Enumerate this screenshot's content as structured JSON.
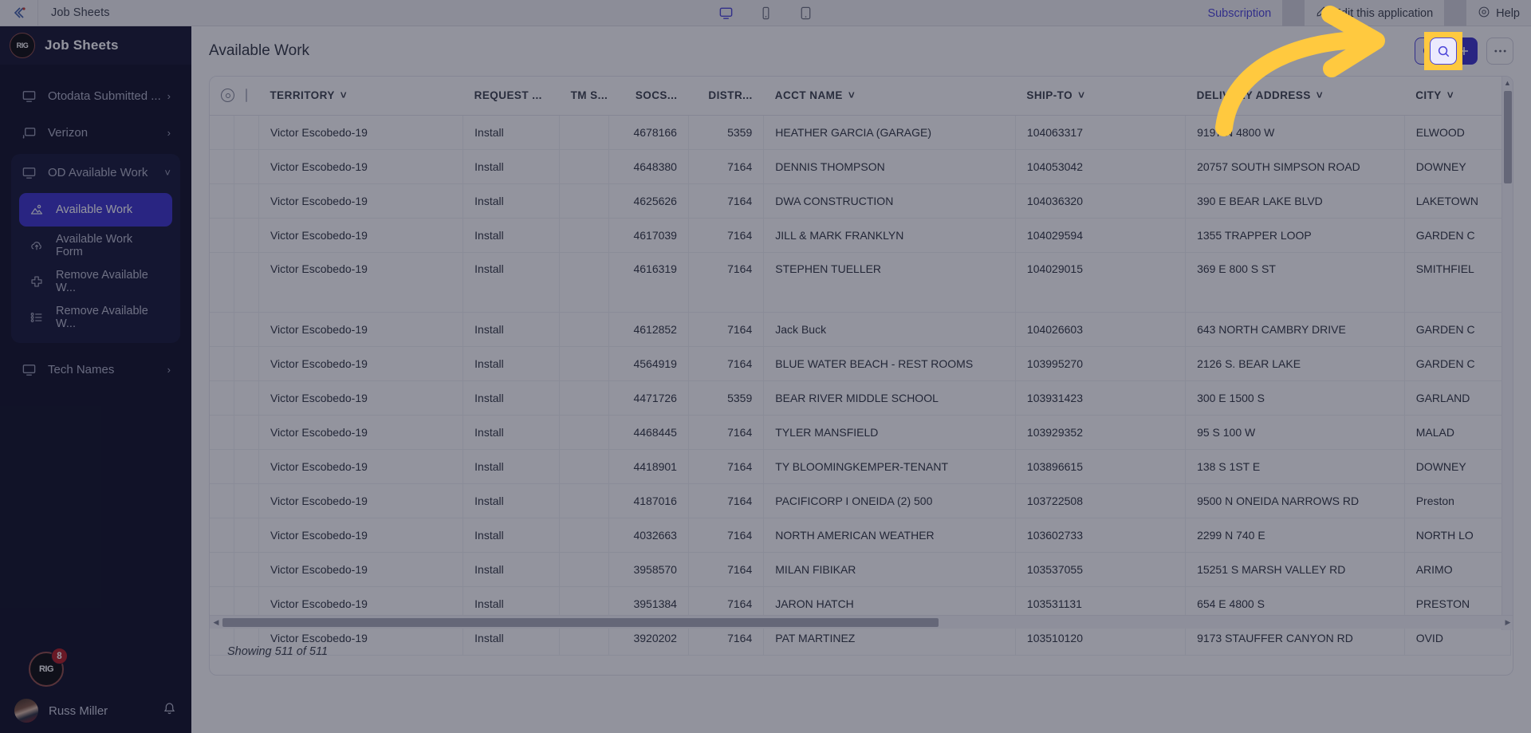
{
  "topbar": {
    "app_title": "Job Sheets",
    "devices": [
      {
        "name": "desktop-preview-icon",
        "active": true
      },
      {
        "name": "mobile-preview-icon",
        "active": false
      },
      {
        "name": "tablet-preview-icon",
        "active": false
      }
    ],
    "subscription_label": "Subscription",
    "edit_label": "Edit this application",
    "help_label": "Help"
  },
  "sidebar": {
    "brand": "Job Sheets",
    "logo_text": "RIG",
    "items": [
      {
        "label": "Otodata Submitted ...",
        "icon": "monitor-icon",
        "chevron": "right"
      },
      {
        "label": "Verizon",
        "icon": "cast-screen-icon",
        "chevron": "right"
      }
    ],
    "group": {
      "label": "OD Available Work",
      "icon": "monitor-icon",
      "chevron": "down",
      "children": [
        {
          "label": "Available Work",
          "icon": "image-icon",
          "active": true
        },
        {
          "label": "Available Work Form",
          "icon": "cloud-upload-icon",
          "active": false
        },
        {
          "label": "Remove Available W...",
          "icon": "plus-square-icon",
          "active": false
        },
        {
          "label": "Remove Available W...",
          "icon": "list-icon",
          "active": false
        }
      ]
    },
    "trailing": [
      {
        "label": "Tech Names",
        "icon": "monitor-icon",
        "chevron": "right"
      }
    ],
    "footer": {
      "badge_count": "8",
      "logo_text": "RIG",
      "user_name": "Russ Miller",
      "bell_icon": "bell-icon"
    }
  },
  "main": {
    "page_title": "Available Work",
    "actions": [
      {
        "name": "search-button",
        "icon": "search-icon"
      },
      {
        "name": "add-button",
        "icon": "plus-icon"
      },
      {
        "name": "more-button",
        "icon": "ellipsis-icon"
      }
    ],
    "table": {
      "columns": [
        {
          "key": "eye",
          "label": "",
          "icon": "visibility-icon",
          "sortable": false
        },
        {
          "key": "check",
          "label": "",
          "icon": "checkbox-icon",
          "sortable": false
        },
        {
          "key": "territory",
          "label": "TERRITORY",
          "sortable": true
        },
        {
          "key": "request",
          "label": "REQUEST ...",
          "sortable": false
        },
        {
          "key": "tms",
          "label": "TM S...",
          "sortable": false
        },
        {
          "key": "socs",
          "label": "SOCS...",
          "sortable": false
        },
        {
          "key": "distr",
          "label": "DISTR...",
          "sortable": false
        },
        {
          "key": "acct",
          "label": "ACCT NAME",
          "sortable": true
        },
        {
          "key": "ship",
          "label": "SHIP-TO",
          "sortable": true
        },
        {
          "key": "addr",
          "label": "DELIVERY ADDRESS",
          "sortable": true
        },
        {
          "key": "city",
          "label": "CITY",
          "sortable": true
        }
      ],
      "rows": [
        {
          "territory": "Victor Escobedo-19",
          "request": "Install",
          "tms": "",
          "socs": "4678166",
          "distr": "5359",
          "acct": "HEATHER GARCIA (GARAGE)",
          "ship": "104063317",
          "addr": "9197 N 4800 W",
          "city": "ELWOOD",
          "tall": false
        },
        {
          "territory": "Victor Escobedo-19",
          "request": "Install",
          "tms": "",
          "socs": "4648380",
          "distr": "7164",
          "acct": "DENNIS THOMPSON",
          "ship": "104053042",
          "addr": "20757 SOUTH SIMPSON ROAD",
          "city": "DOWNEY",
          "tall": false
        },
        {
          "territory": "Victor Escobedo-19",
          "request": "Install",
          "tms": "",
          "socs": "4625626",
          "distr": "7164",
          "acct": "DWA CONSTRUCTION",
          "ship": "104036320",
          "addr": "390 E BEAR LAKE BLVD",
          "city": "LAKETOWN",
          "tall": false
        },
        {
          "territory": "Victor Escobedo-19",
          "request": "Install",
          "tms": "",
          "socs": "4617039",
          "distr": "7164",
          "acct": "JILL & MARK FRANKLYN",
          "ship": "104029594",
          "addr": "1355 TRAPPER LOOP",
          "city": "GARDEN C",
          "tall": false
        },
        {
          "territory": "Victor Escobedo-19",
          "request": "Install",
          "tms": "",
          "socs": "4616319",
          "distr": "7164",
          "acct": "STEPHEN TUELLER",
          "ship": "104029015",
          "addr": "369 E 800 S ST",
          "city": "SMITHFIEL",
          "tall": true
        },
        {
          "territory": "Victor Escobedo-19",
          "request": "Install",
          "tms": "",
          "socs": "4612852",
          "distr": "7164",
          "acct": "Jack Buck",
          "ship": "104026603",
          "addr": "643 NORTH CAMBRY DRIVE",
          "city": "GARDEN C",
          "tall": false
        },
        {
          "territory": "Victor Escobedo-19",
          "request": "Install",
          "tms": "",
          "socs": "4564919",
          "distr": "7164",
          "acct": "BLUE WATER BEACH - REST ROOMS",
          "ship": "103995270",
          "addr": "2126 S. BEAR LAKE",
          "city": "GARDEN C",
          "tall": false
        },
        {
          "territory": "Victor Escobedo-19",
          "request": "Install",
          "tms": "",
          "socs": "4471726",
          "distr": "5359",
          "acct": "BEAR RIVER MIDDLE SCHOOL",
          "ship": "103931423",
          "addr": "300 E 1500 S",
          "city": "GARLAND",
          "tall": false
        },
        {
          "territory": "Victor Escobedo-19",
          "request": "Install",
          "tms": "",
          "socs": "4468445",
          "distr": "7164",
          "acct": "TYLER MANSFIELD",
          "ship": "103929352",
          "addr": "95 S 100 W",
          "city": "MALAD",
          "tall": false
        },
        {
          "territory": "Victor Escobedo-19",
          "request": "Install",
          "tms": "",
          "socs": "4418901",
          "distr": "7164",
          "acct": "TY BLOOMINGKEMPER-TENANT",
          "ship": "103896615",
          "addr": "138 S 1ST E",
          "city": "DOWNEY",
          "tall": false
        },
        {
          "territory": "Victor Escobedo-19",
          "request": "Install",
          "tms": "",
          "socs": "4187016",
          "distr": "7164",
          "acct": "PACIFICORP I ONEIDA (2) 500",
          "ship": "103722508",
          "addr": "9500 N ONEIDA NARROWS RD",
          "city": "Preston",
          "tall": false
        },
        {
          "territory": "Victor Escobedo-19",
          "request": "Install",
          "tms": "",
          "socs": "4032663",
          "distr": "7164",
          "acct": "NORTH AMERICAN WEATHER",
          "ship": "103602733",
          "addr": "2299 N 740 E",
          "city": "NORTH LO",
          "tall": false
        },
        {
          "territory": "Victor Escobedo-19",
          "request": "Install",
          "tms": "",
          "socs": "3958570",
          "distr": "7164",
          "acct": "MILAN FIBIKAR",
          "ship": "103537055",
          "addr": "15251 S MARSH VALLEY RD",
          "city": "ARIMO",
          "tall": false
        },
        {
          "territory": "Victor Escobedo-19",
          "request": "Install",
          "tms": "",
          "socs": "3951384",
          "distr": "7164",
          "acct": "JARON HATCH",
          "ship": "103531131",
          "addr": "654 E 4800 S",
          "city": "PRESTON",
          "tall": false
        },
        {
          "territory": "Victor Escobedo-19",
          "request": "Install",
          "tms": "",
          "socs": "3920202",
          "distr": "7164",
          "acct": "PAT MARTINEZ",
          "ship": "103510120",
          "addr": "9173 STAUFFER CANYON RD",
          "city": "OVID",
          "tall": false
        }
      ]
    },
    "footer_text": "Showing 511 of 511"
  },
  "annotation": {
    "type": "curved-arrow",
    "color": "#ffc93f",
    "target": "search-button"
  },
  "colors": {
    "accent": "#3a31c9",
    "link": "#4a43d8",
    "sidebar_bg": "#0d0e24",
    "highlight": "#ffc93f",
    "badge_red": "#b01b20"
  }
}
